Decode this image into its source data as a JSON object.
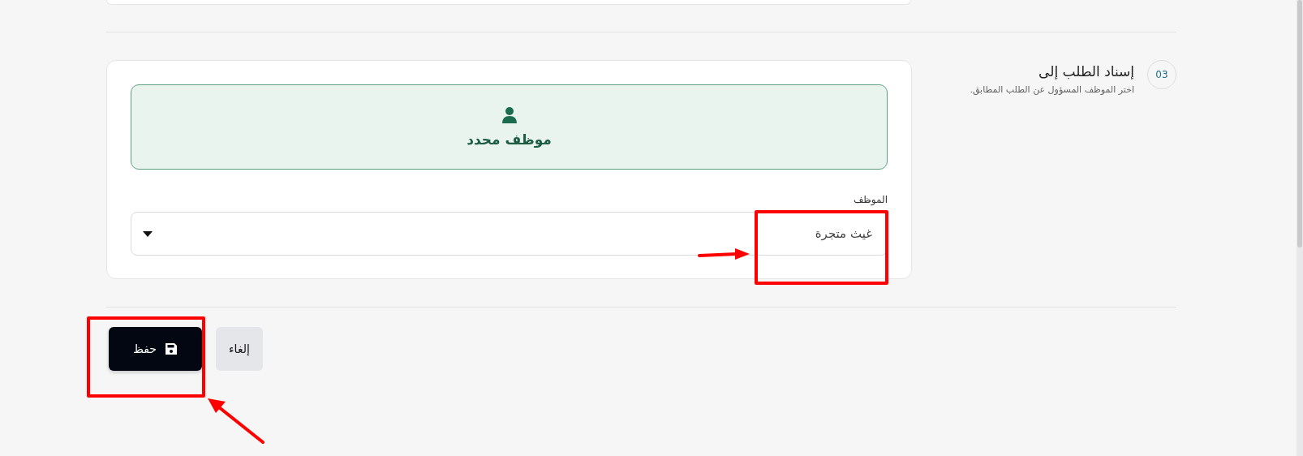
{
  "section": {
    "number": "03",
    "title": "إسناد الطلب إلى",
    "subtitle": "اختر الموظف المسؤول عن الطلب المطابق."
  },
  "assign_options": [
    {
      "label": "موظف محدد",
      "selected": true
    }
  ],
  "employee_field": {
    "label": "الموظف",
    "value": "غيث متجرة"
  },
  "buttons": [
    {
      "label": "إلغاء",
      "kind": "secondary"
    },
    {
      "label": "حفظ",
      "kind": "primary"
    }
  ]
}
